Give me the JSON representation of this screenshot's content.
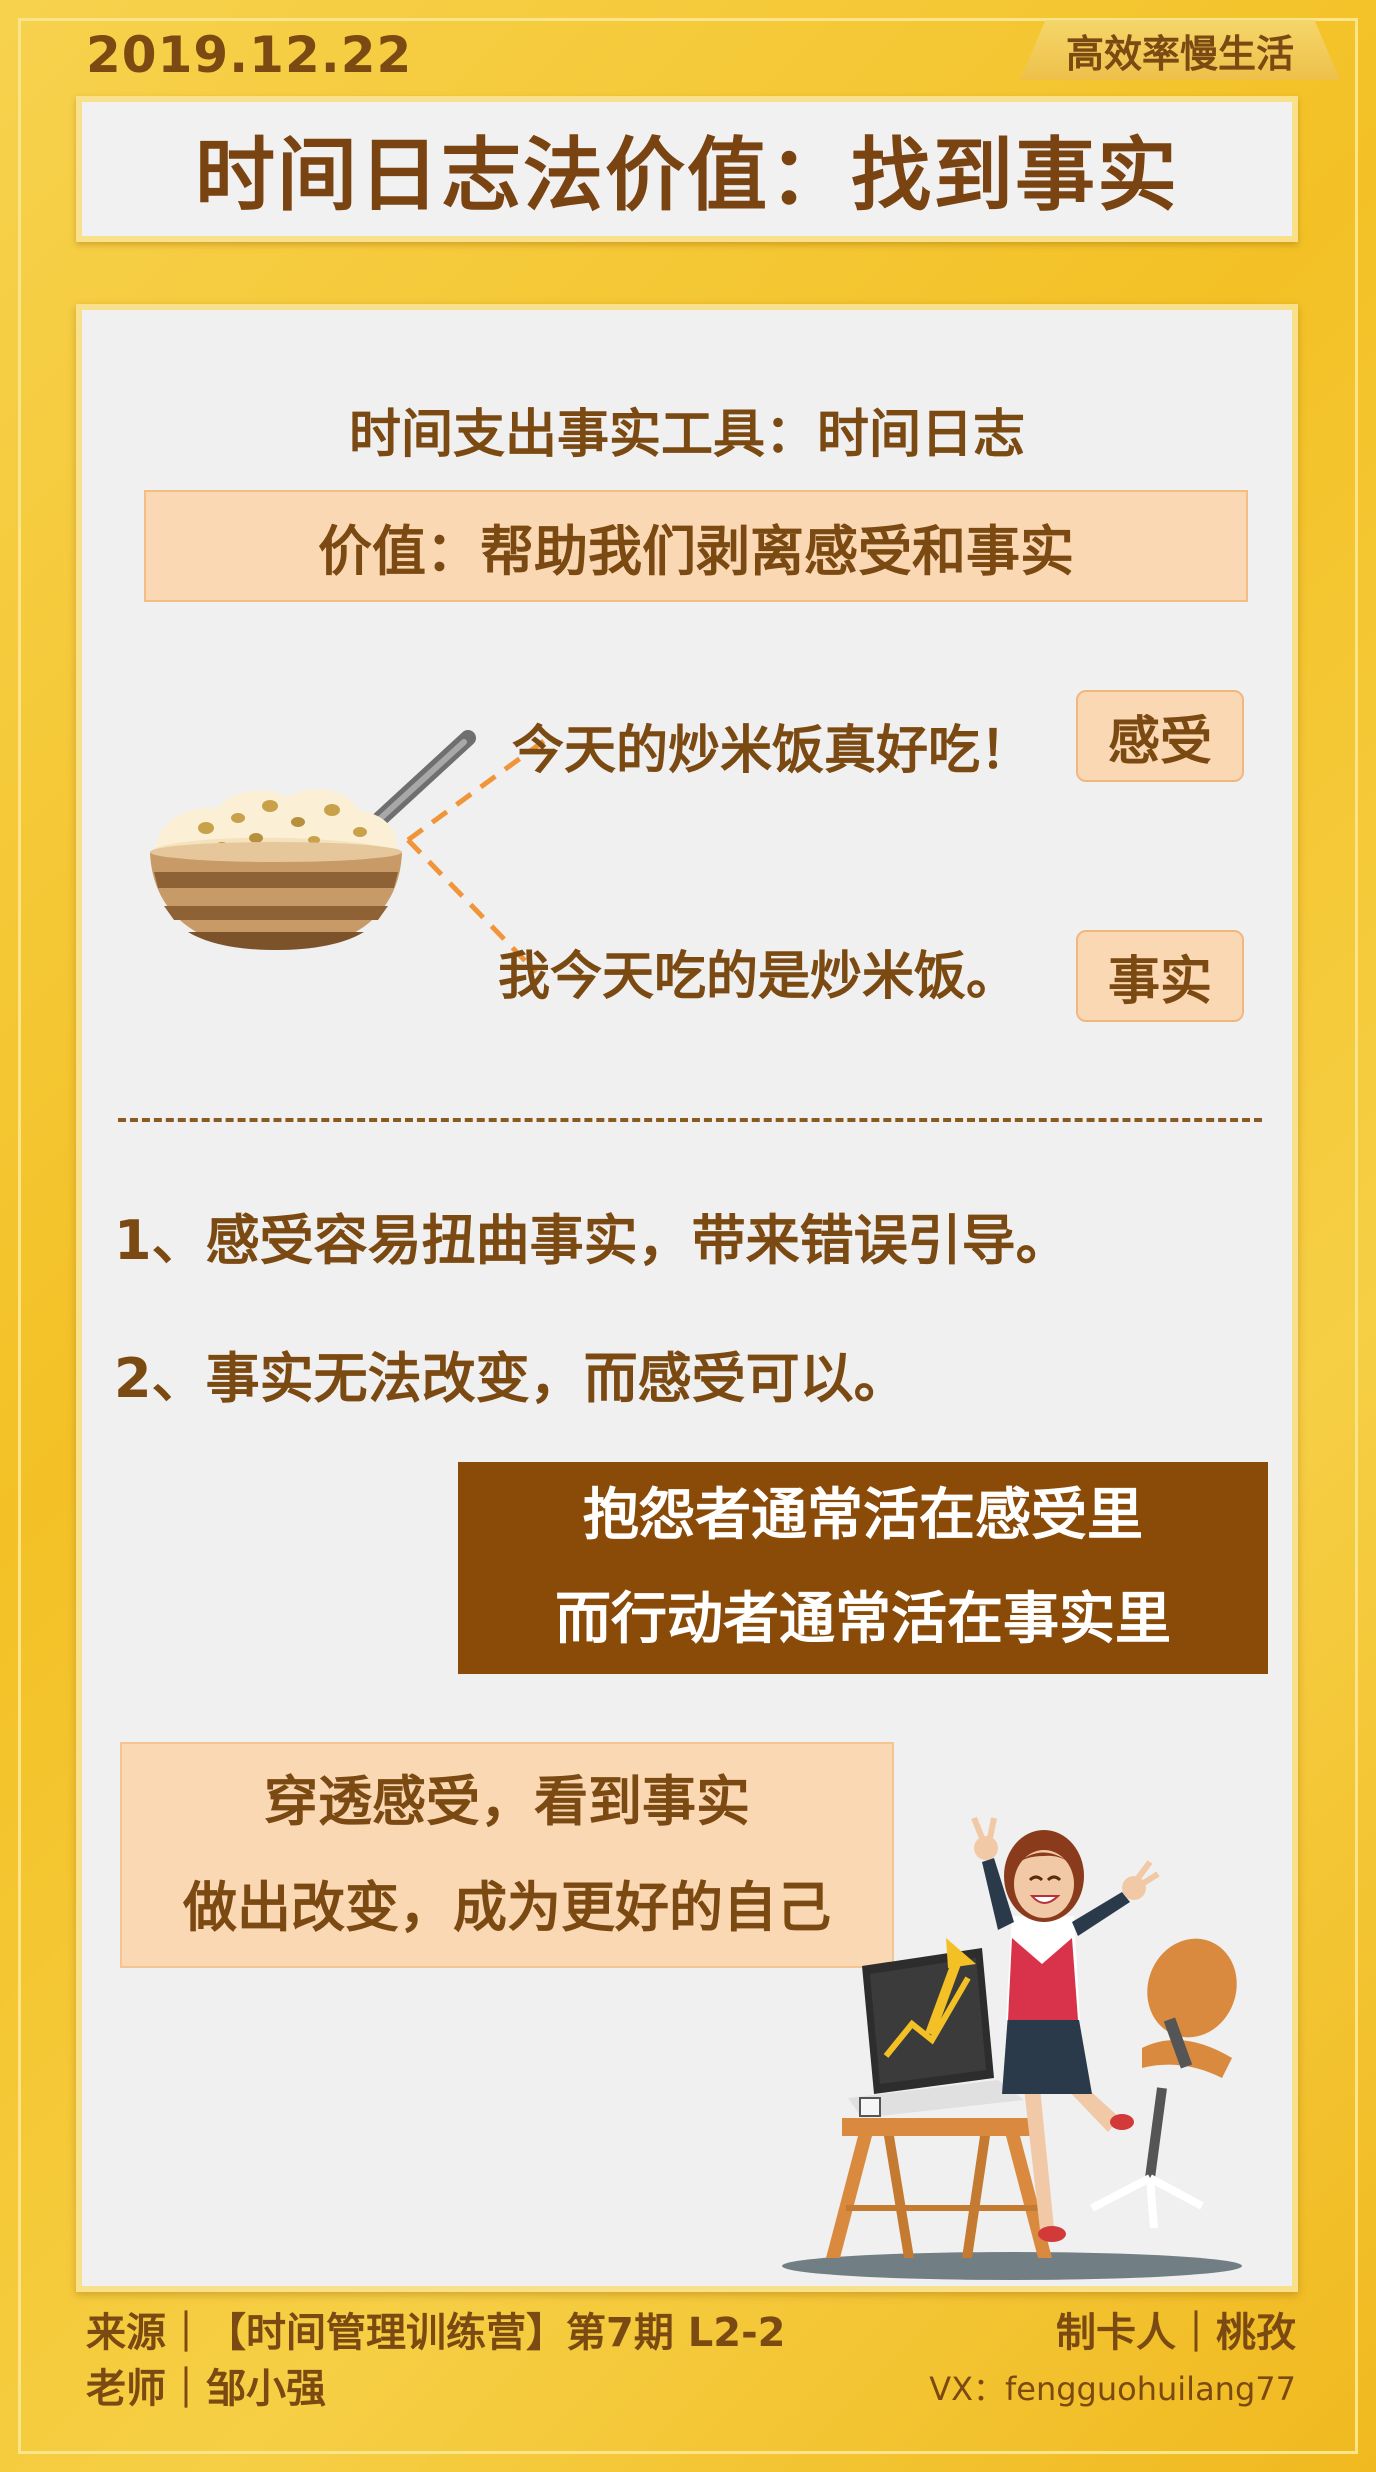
{
  "header": {
    "date": "2019.12.22",
    "brand": "高效率慢生活",
    "title": "时间日志法价值：找到事实"
  },
  "main": {
    "subtitle": "时间支出事实工具：时间日志",
    "value_statement": "价值：帮助我们剥离感受和事实",
    "example": {
      "feeling_text": "今天的炒米饭真好吃！",
      "feeling_tag": "感受",
      "fact_text": "我今天吃的是炒米饭。",
      "fact_tag": "事实"
    },
    "points": [
      "1、感受容易扭曲事实，带来错误引导。",
      "2、事实无法改变，而感受可以。"
    ],
    "dark_box": {
      "line1": "抱怨者通常活在感受里",
      "line2": "而行动者通常活在事实里"
    },
    "peach_box": {
      "line1": "穿透感受，看到事实",
      "line2": "做出改变，成为更好的自己"
    }
  },
  "footer": {
    "source": "来源｜【时间管理训练营】第7期  L2-2",
    "teacher": "老师｜邹小强",
    "maker": "制卡人｜桃孜",
    "vx": "VX：fengguohuilang77"
  },
  "colors": {
    "background": "#f3c126",
    "panel": "#f0f0f0",
    "text_brown": "#7b4a12",
    "peach": "#fbd8b4",
    "dark_brown": "#8a4a08"
  }
}
